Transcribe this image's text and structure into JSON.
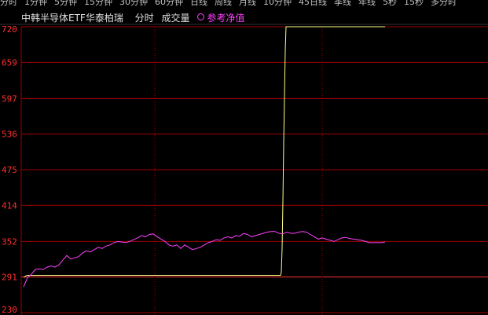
{
  "menu": {
    "tabs": [
      "分时",
      "1分钟",
      "5分钟",
      "15分钟",
      "30分钟",
      "60分钟",
      "日线",
      "周线",
      "月线",
      "10分钟",
      "45日线",
      "季线",
      "年线",
      "5秒",
      "15秒",
      "多分时"
    ]
  },
  "header": {
    "name": "中韩半导体ETF华泰柏瑞",
    "mode": "分时",
    "volume": "成交量",
    "nav_label": "参考净值"
  },
  "colors": {
    "background": "#000000",
    "grid": "#a00000",
    "axis_label": "#ff3030",
    "price_line": "#ffff88",
    "nav_line": "#ff40ff",
    "ref_line": "#ff3030"
  },
  "chart_data": {
    "type": "line",
    "yticks": [
      720,
      659,
      597,
      536,
      475,
      414,
      352,
      291,
      230
    ],
    "ylim": [
      230,
      720
    ],
    "reference": 291,
    "series": [
      {
        "name": "",
        "x": [
          0,
          1,
          2,
          3,
          5,
          10,
          20,
          40,
          60,
          80,
          100,
          120,
          140,
          160,
          180,
          200,
          220,
          240,
          260,
          280,
          300,
          320,
          327,
          328,
          329,
          330,
          331,
          332,
          333,
          334,
          340,
          360,
          380,
          400,
          420,
          440,
          460
        ],
        "values": [
          291,
          291,
          292,
          293,
          294,
          294,
          294,
          294,
          294,
          294,
          294,
          294,
          294,
          294,
          294,
          294,
          294,
          294,
          294,
          294,
          294,
          294,
          294,
          300,
          340,
          420,
          520,
          600,
          680,
          720,
          720,
          720,
          720,
          720,
          720,
          720,
          720
        ]
      },
      {
        "name": "参考净值",
        "x": [
          0,
          5,
          10,
          15,
          20,
          25,
          30,
          35,
          40,
          45,
          50,
          55,
          60,
          65,
          70,
          75,
          80,
          85,
          90,
          95,
          100,
          105,
          110,
          115,
          120,
          125,
          130,
          135,
          140,
          145,
          150,
          155,
          160,
          165,
          170,
          175,
          180,
          185,
          190,
          195,
          200,
          205,
          210,
          215,
          220,
          225,
          230,
          235,
          240,
          245,
          250,
          255,
          260,
          265,
          270,
          275,
          280,
          285,
          290,
          295,
          300,
          305,
          310,
          315,
          320,
          325,
          330,
          335,
          340,
          345,
          350,
          355,
          360,
          365,
          370,
          375,
          380,
          385,
          390,
          395,
          400,
          405,
          410,
          415,
          420,
          425,
          430,
          435,
          440,
          445,
          450,
          455,
          460
        ],
        "values": [
          274,
          290,
          296,
          304,
          305,
          304,
          308,
          310,
          308,
          312,
          320,
          328,
          322,
          324,
          326,
          332,
          336,
          334,
          338,
          342,
          340,
          344,
          346,
          350,
          352,
          351,
          350,
          352,
          355,
          358,
          362,
          360,
          364,
          365,
          360,
          356,
          352,
          346,
          344,
          346,
          340,
          346,
          342,
          338,
          340,
          342,
          346,
          350,
          352,
          355,
          354,
          358,
          360,
          358,
          362,
          361,
          366,
          364,
          360,
          362,
          364,
          366,
          368,
          369,
          369,
          366,
          365,
          368,
          366,
          366,
          368,
          369,
          368,
          364,
          360,
          356,
          358,
          356,
          354,
          352,
          355,
          358,
          359,
          357,
          356,
          355,
          354,
          352,
          350,
          350,
          350,
          350,
          351
        ]
      }
    ]
  }
}
